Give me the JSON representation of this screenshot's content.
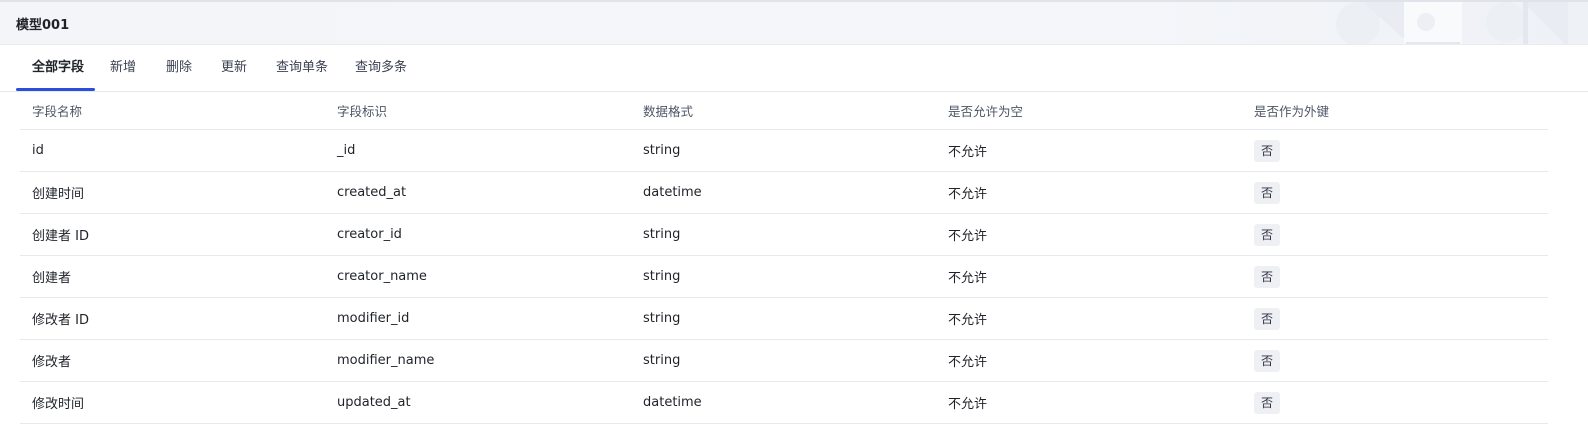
{
  "header": {
    "title": "模型001"
  },
  "tabs": [
    {
      "label": "全部字段",
      "active": true
    },
    {
      "label": "新增",
      "active": false
    },
    {
      "label": "删除",
      "active": false
    },
    {
      "label": "更新",
      "active": false
    },
    {
      "label": "查询单条",
      "active": false
    },
    {
      "label": "查询多条",
      "active": false
    }
  ],
  "table": {
    "columns": [
      "字段名称",
      "字段标识",
      "数据格式",
      "是否允许为空",
      "是否作为外键"
    ],
    "rows": [
      {
        "name": "id",
        "key": "_id",
        "format": "string",
        "nullable": "不允许",
        "foreign": "否"
      },
      {
        "name": "创建时间",
        "key": "created_at",
        "format": "datetime",
        "nullable": "不允许",
        "foreign": "否"
      },
      {
        "name": "创建者 ID",
        "key": "creator_id",
        "format": "string",
        "nullable": "不允许",
        "foreign": "否"
      },
      {
        "name": "创建者",
        "key": "creator_name",
        "format": "string",
        "nullable": "不允许",
        "foreign": "否"
      },
      {
        "name": "修改者 ID",
        "key": "modifier_id",
        "format": "string",
        "nullable": "不允许",
        "foreign": "否"
      },
      {
        "name": "修改者",
        "key": "modifier_name",
        "format": "string",
        "nullable": "不允许",
        "foreign": "否"
      },
      {
        "name": "修改时间",
        "key": "updated_at",
        "format": "datetime",
        "nullable": "不允许",
        "foreign": "否"
      }
    ]
  },
  "colors": {
    "accent": "#2b4fd8",
    "tag_bg": "#eef0f4",
    "header_bg": "#f3f5f9"
  }
}
